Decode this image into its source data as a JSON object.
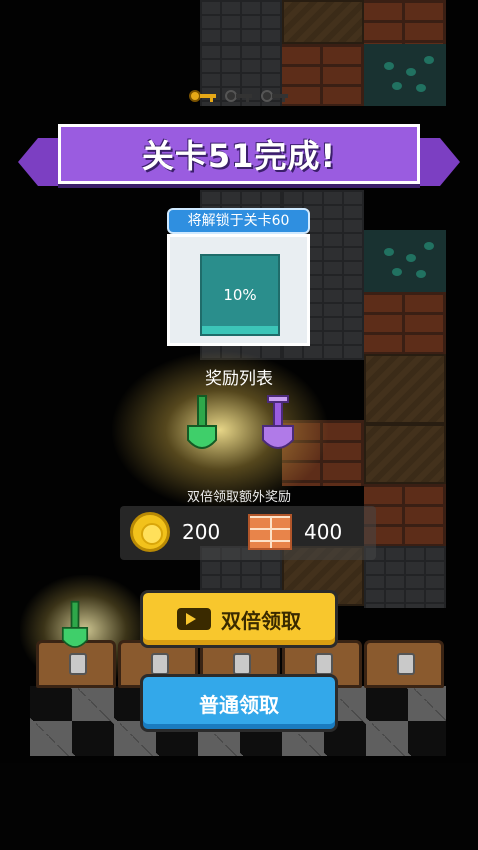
{
  "banner": {
    "title": "关卡51完成!"
  },
  "unlock": {
    "label": "将解锁于关卡60",
    "progress_text": "10%",
    "progress_value": 0.1
  },
  "rewards": {
    "title": "奖励列表",
    "items": [
      "green-shovel-icon",
      "purple-shovel-icon"
    ]
  },
  "bonus": {
    "title": "双倍领取额外奖励",
    "coins": "200",
    "bricks": "400"
  },
  "buttons": {
    "double_label": "双倍领取",
    "normal_label": "普通领取"
  },
  "colors": {
    "banner": "#9a5ce0",
    "double_button": "#f8c72d",
    "normal_button": "#33a8ea",
    "unlock_label": "#2f8fe0"
  }
}
